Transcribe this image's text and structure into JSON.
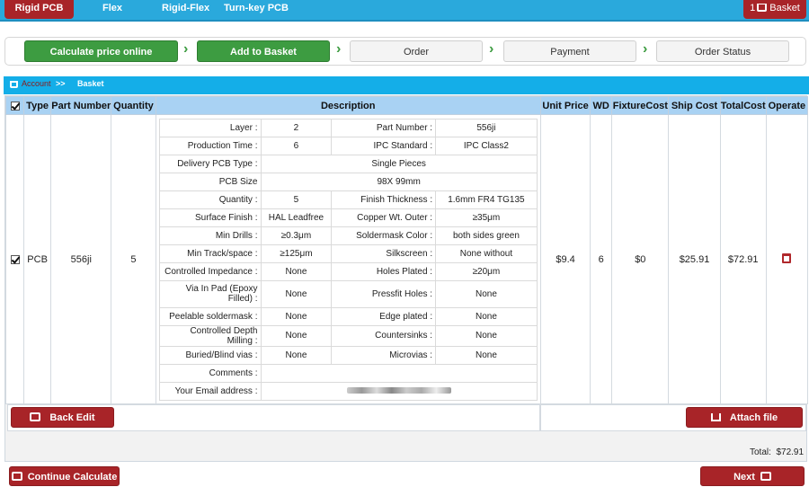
{
  "nav": {
    "tabs": [
      "Rigid PCB",
      "Flex",
      "Rigid-Flex",
      "Turn-key PCB"
    ],
    "basket_count": "1",
    "basket_label": "Basket"
  },
  "steps": [
    "Calculate price online",
    "Add to Basket",
    "Order",
    "Payment",
    "Order Status"
  ],
  "breadcrumb": {
    "account": "Account",
    "sep": ">>",
    "current": "Basket"
  },
  "table": {
    "headers": [
      "Type",
      "Part Number",
      "Quantity",
      "Description",
      "Unit Price",
      "WD",
      "FixtureCost",
      "Ship Cost",
      "TotalCost",
      "Operate"
    ],
    "row": {
      "type": "PCB",
      "part": "556ji",
      "qty": "5",
      "unit": "$9.4",
      "wd": "6",
      "fixture": "$0",
      "ship": "$25.91",
      "total": "$72.91"
    }
  },
  "desc": [
    {
      "l": "Layer :",
      "v": "2",
      "l2": "Part Number :",
      "v2": "556ji"
    },
    {
      "l": "Production Time :",
      "v": "6",
      "l2": "IPC Standard :",
      "v2": "IPC Class2"
    },
    {
      "l": "Delivery PCB Type :",
      "span": "Single Pieces"
    },
    {
      "l": "PCB Size",
      "span": "98X   99mm"
    },
    {
      "l": "Quantity :",
      "v": "5",
      "l2": "Finish Thickness :",
      "v2": "1.6mm   FR4 TG135"
    },
    {
      "l": "Surface Finish :",
      "v": "HAL Leadfree",
      "l2": "Copper Wt. Outer :",
      "v2": "≥35μm"
    },
    {
      "l": "Min Drills :",
      "v": "≥0.3μm",
      "l2": "Soldermask Color :",
      "v2": "both sides  green"
    },
    {
      "l": "Min Track/space :",
      "v": "≥125μm",
      "l2": "Silkscreen :",
      "v2": "None  without"
    },
    {
      "l": "Controlled Impedance :",
      "v": "None",
      "l2": "Holes Plated :",
      "v2": "≥20μm"
    },
    {
      "l": "Via In Pad (Epoxy Filled) :",
      "v": "None",
      "l2": "Pressfit Holes :",
      "v2": "None"
    },
    {
      "l": "Peelable soldermask :",
      "v": "None",
      "l2": "Edge plated :",
      "v2": "None"
    },
    {
      "l": "Controlled Depth Milling :",
      "v": "None",
      "l2": "Countersinks :",
      "v2": "None"
    },
    {
      "l": "Buried/Blind vias :",
      "v": "None",
      "l2": "Microvias :",
      "v2": "None"
    },
    {
      "l": "Comments :",
      "span": ""
    },
    {
      "l": "Your Email address :",
      "span": ""
    }
  ],
  "buttons": {
    "back": "Back Edit",
    "attach": "Attach file",
    "continue": "Continue Calculate",
    "next": "Next"
  },
  "total": {
    "label": "Total:",
    "value": "$72.91"
  }
}
